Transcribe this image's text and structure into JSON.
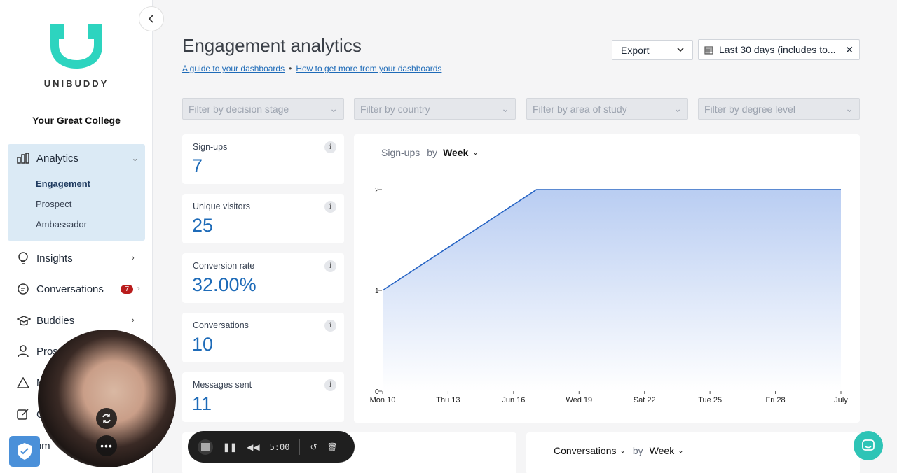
{
  "sidebar": {
    "brand": "UNIBUDDY",
    "college": "Your Great College",
    "analytics": {
      "label": "Analytics",
      "sub": [
        "Engagement",
        "Prospect",
        "Ambassador"
      ]
    },
    "items": [
      {
        "label": "Insights",
        "icon": "lightbulb-icon"
      },
      {
        "label": "Conversations",
        "icon": "chat-icon",
        "badge": "7"
      },
      {
        "label": "Buddies",
        "icon": "graduation-cap-icon"
      },
      {
        "label": "Pros",
        "icon": "person-icon"
      },
      {
        "label": "M",
        "icon": "warning-icon"
      },
      {
        "label": "C",
        "icon": "edit-icon"
      },
      {
        "label": "Com",
        "icon": "community-icon"
      }
    ]
  },
  "header": {
    "title": "Engagement analytics",
    "link1": "A guide to your dashboards",
    "link2": "How to get more from your dashboards",
    "export": "Export",
    "date_range": "Last 30 days (includes to..."
  },
  "filters": [
    "Filter by decision stage",
    "Filter by country",
    "Filter by area of study",
    "Filter by degree level"
  ],
  "stats": [
    {
      "label": "Sign-ups",
      "value": "7"
    },
    {
      "label": "Unique visitors",
      "value": "25"
    },
    {
      "label": "Conversion rate",
      "value": "32.00%"
    },
    {
      "label": "Conversations",
      "value": "10"
    },
    {
      "label": "Messages sent",
      "value": "11"
    }
  ],
  "chart_header": {
    "metric": "Sign-ups",
    "by": "by",
    "period": "Week"
  },
  "chart_data": {
    "type": "area",
    "x": [
      "Mon 10",
      "Thu 13",
      "Jun 16",
      "Wed 19",
      "Sat 22",
      "Tue 25",
      "Fri 28",
      "July"
    ],
    "series": [
      {
        "points": [
          [
            0,
            1
          ],
          [
            2.35,
            2
          ],
          [
            7,
            2
          ]
        ]
      }
    ],
    "yticks": [
      0,
      1,
      2
    ],
    "ylim": [
      0,
      2
    ],
    "grid": false,
    "colors": {
      "line": "#2563c4",
      "fill_top": "#b9cdf2",
      "fill_bottom": "#ffffff"
    }
  },
  "bottom": {
    "conversations": {
      "metric": "Conversations",
      "by": "by",
      "period": "Week"
    }
  },
  "recorder": {
    "time": "5:00"
  },
  "colors": {
    "accent": "#1e6bb8",
    "teal": "#2ec4b6",
    "badge": "#b91c1c"
  }
}
